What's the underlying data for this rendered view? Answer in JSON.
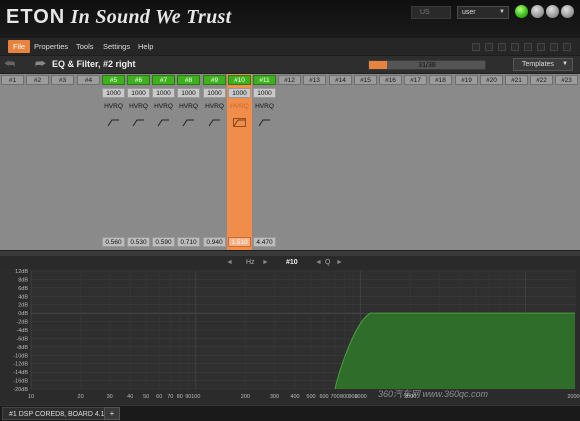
{
  "brand": {
    "name": "ETON",
    "slogan": "In Sound We Trust"
  },
  "titlebar": {
    "language_value": "US",
    "user_value": "user"
  },
  "menu": {
    "items": [
      "File",
      "Properties",
      "Tools",
      "Settings",
      "Help"
    ]
  },
  "nav": {
    "title": "EQ & Filter, #2 right",
    "progress_label": "31/38",
    "progress_fraction": 0.158,
    "templates_label": "Templates"
  },
  "channels": [
    {
      "label": "#1",
      "active": false
    },
    {
      "label": "#2",
      "active": false
    },
    {
      "label": "#3",
      "active": false
    },
    {
      "label": "#4",
      "active": false
    },
    {
      "label": "#5",
      "active": true,
      "freq": "1000",
      "type": "HVRQ",
      "q": "0.560"
    },
    {
      "label": "#6",
      "active": true,
      "freq": "1000",
      "type": "HVRQ",
      "q": "0.530"
    },
    {
      "label": "#7",
      "active": true,
      "freq": "1000",
      "type": "HVRQ",
      "q": "0.590"
    },
    {
      "label": "#8",
      "active": true,
      "freq": "1000",
      "type": "HVRQ",
      "q": "0.710"
    },
    {
      "label": "#9",
      "active": true,
      "freq": "1000",
      "type": "HVRQ",
      "q": "0.940"
    },
    {
      "label": "#10",
      "active": true,
      "selected": true,
      "freq": "1000",
      "type": "HVRQ",
      "q": "1.510"
    },
    {
      "label": "#11",
      "active": true,
      "freq": "1000",
      "type": "HVRQ",
      "q": "4.470"
    },
    {
      "label": "#12",
      "active": false
    },
    {
      "label": "#13",
      "active": false
    },
    {
      "label": "#14",
      "active": false
    },
    {
      "label": "#15",
      "active": false
    },
    {
      "label": "#16",
      "active": false
    },
    {
      "label": "#17",
      "active": false
    },
    {
      "label": "#18",
      "active": false
    },
    {
      "label": "#19",
      "active": false
    },
    {
      "label": "#20",
      "active": false
    },
    {
      "label": "#21",
      "active": false
    },
    {
      "label": "#22",
      "active": false
    },
    {
      "label": "#23",
      "active": false
    }
  ],
  "graph_header": {
    "hz_label": "Hz",
    "channel_label": "#10",
    "q_label": "Q",
    "arrow_left": "◄",
    "arrow_right": "►"
  },
  "graph": {
    "y_labels": [
      "12dB",
      "8dB",
      "6dB",
      "4dB",
      "2dB",
      "0dB",
      "-2dB",
      "-4dB",
      "-6dB",
      "-8dB",
      "-10dB",
      "-12dB",
      "-14dB",
      "-16dB",
      "-20dB"
    ],
    "x_labels": [
      "10",
      "20",
      "30",
      "40",
      "50",
      "60",
      "70",
      "80",
      "90",
      "100",
      "200",
      "300",
      "400",
      "500",
      "600",
      "700",
      "800",
      "900",
      "1000",
      "2000",
      "20000"
    ],
    "fill_color": "#2f6e2a",
    "line_color": "#4a9f3c"
  },
  "watermark": {
    "text": "360汽车网 www.360qc.com"
  },
  "tabs": {
    "main_label": "#1 DSP CORED8, BOARD 4.1",
    "add_label": "+"
  }
}
